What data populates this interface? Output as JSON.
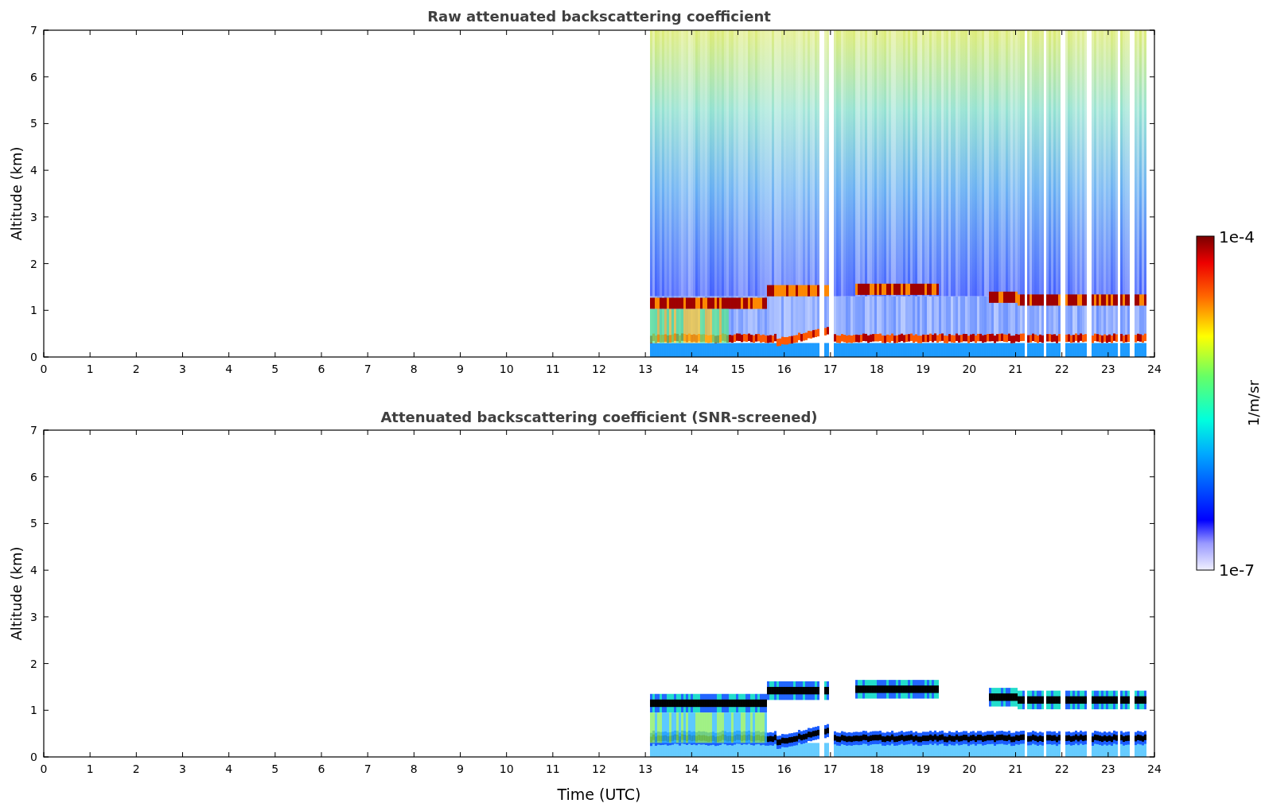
{
  "figure": {
    "panels": [
      {
        "kind": "raw",
        "title": "Raw attenuated backscattering coefficient",
        "ylabel": "Altitude (km)",
        "yticks": [
          "7",
          "6",
          "5",
          "4",
          "3",
          "2",
          "1",
          "0"
        ],
        "xticks": [
          "0",
          "1",
          "2",
          "3",
          "4",
          "5",
          "6",
          "7",
          "8",
          "9",
          "10",
          "11",
          "12",
          "13",
          "14",
          "15",
          "16",
          "17",
          "18",
          "19",
          "20",
          "21",
          "22",
          "23",
          "24"
        ]
      },
      {
        "kind": "screened",
        "title": "Attenuated backscattering coefficient (SNR-screened)",
        "ylabel": "Altitude (km)",
        "xlabel": "Time (UTC)",
        "yticks": [
          "7",
          "6",
          "5",
          "4",
          "3",
          "2",
          "1",
          "0"
        ],
        "xticks": [
          "0",
          "1",
          "2",
          "3",
          "4",
          "5",
          "6",
          "7",
          "8",
          "9",
          "10",
          "11",
          "12",
          "13",
          "14",
          "15",
          "16",
          "17",
          "18",
          "19",
          "20",
          "21",
          "22",
          "23",
          "24"
        ]
      }
    ],
    "colorbar": {
      "max_label": "1e-4",
      "min_label": "1e-7",
      "unit": "1/m/sr"
    }
  }
}
